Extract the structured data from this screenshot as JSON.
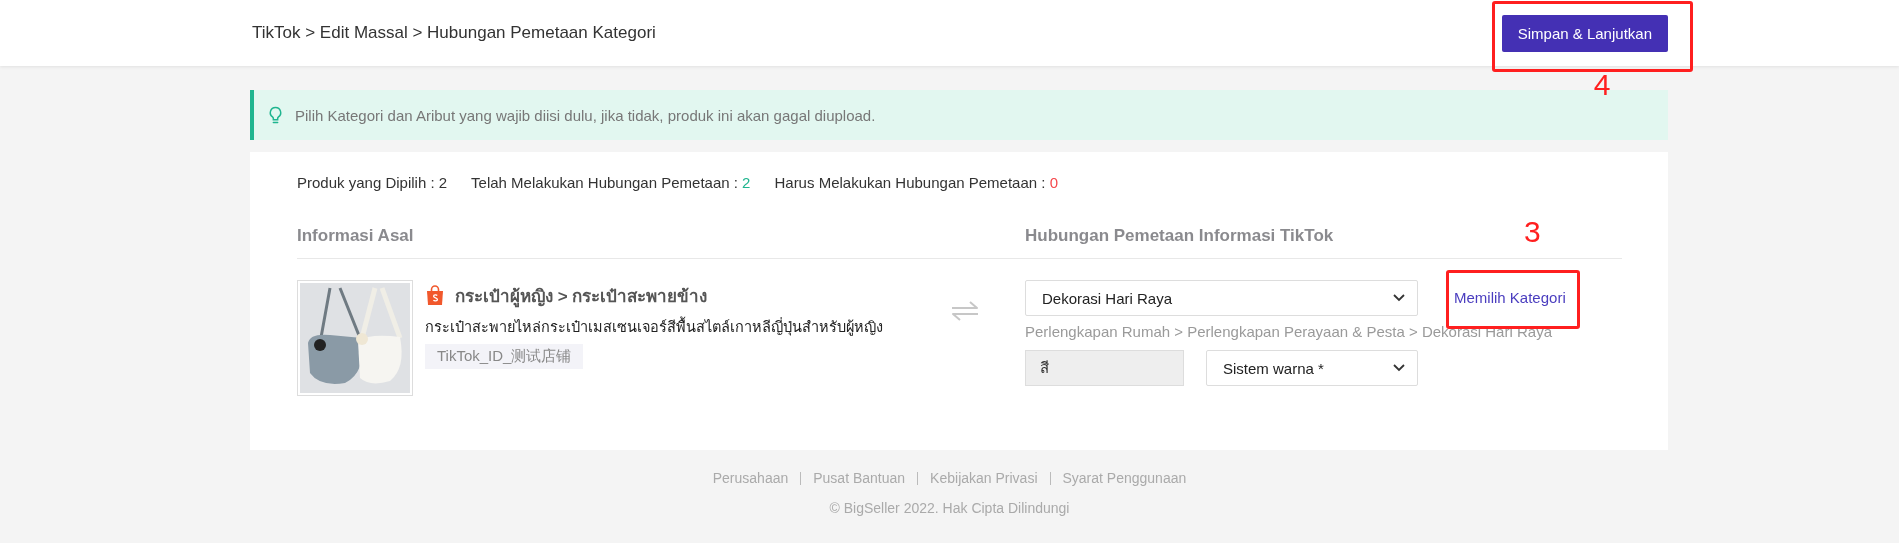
{
  "breadcrumb": "TikTok > Edit Massal > Hubungan Pemetaan Kategori",
  "save_button": {
    "label": "Simpan & Lanjutkan",
    "annotation": "4"
  },
  "tip": "Pilih Kategori dan Aribut yang wajib diisi dulu, jika tidak, produk ini akan gagal diupload.",
  "stats": [
    {
      "label": "Produk yang Dipilih :",
      "value": "2",
      "kind": "plain"
    },
    {
      "label": "Telah Melakukan Hubungan Pemetaan :",
      "value": "2",
      "kind": "done"
    },
    {
      "label": "Harus Melakukan Hubungan Pemetaan :",
      "value": "0",
      "kind": "pending"
    }
  ],
  "columns": [
    "Informasi Asal",
    "Hubungan Pemetaan Informasi TikTok"
  ],
  "product": {
    "category_path": "กระเป๋าผู้หญิง > กระเป๋าสะพายข้าง",
    "title": "กระเป๋าสะพายไหล่กระเป๋าเมสเซนเจอร์สีพื้นสไตล์เกาหลีญี่ปุ่นสำหรับผู้หญิง",
    "store": "TikTok_ID_测试店铺"
  },
  "mapping": {
    "category_select": "Dekorasi Hari Raya",
    "choose_link": {
      "label": "Memilih Kategori",
      "annotation": "3"
    },
    "category_path": "Perlengkapan Rumah > Perlengkapan Perayaan & Pesta > Dekorasi Hari Raya",
    "attribute_name": "สี",
    "attribute_select": "Sistem warna *"
  },
  "footer": {
    "links": [
      "Perusahaan",
      "Pusat Bantuan",
      "Kebijakan Privasi",
      "Syarat Penggunaan"
    ],
    "copyright": "© BigSeller 2022. Hak Cipta Dilindungi"
  }
}
